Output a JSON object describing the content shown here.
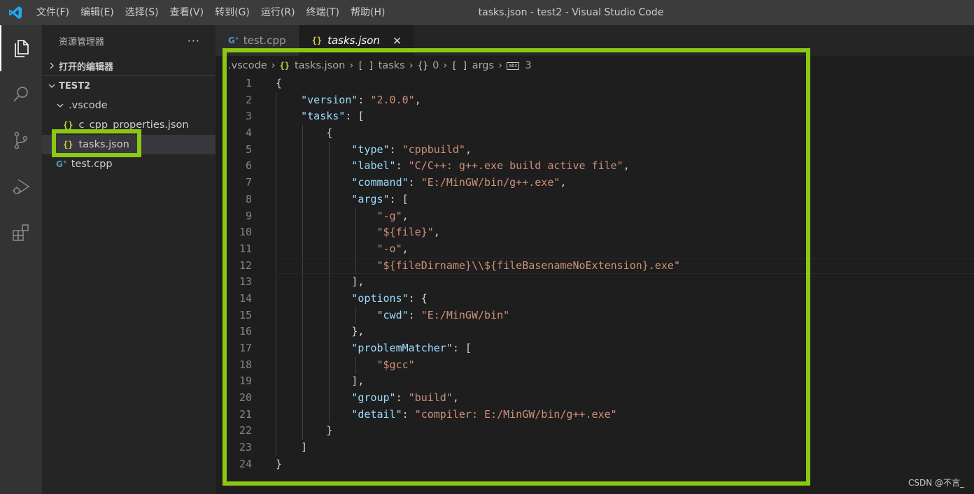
{
  "window_title": "tasks.json - test2 - Visual Studio Code",
  "menu": [
    "文件(F)",
    "编辑(E)",
    "选择(S)",
    "查看(V)",
    "转到(G)",
    "运行(R)",
    "终端(T)",
    "帮助(H)"
  ],
  "sidebar": {
    "title": "资源管理器",
    "more": "···",
    "open_editors": "打开的编辑器",
    "folder": "TEST2",
    "items": [
      {
        "label": ".vscode"
      },
      {
        "label": "c_cpp_properties.json"
      },
      {
        "label": "tasks.json"
      },
      {
        "label": "test.cpp"
      }
    ]
  },
  "tabs": [
    {
      "label": "test.cpp",
      "icon": "G"
    },
    {
      "label": "tasks.json",
      "icon": "{}",
      "close": "✕"
    }
  ],
  "breadcrumb": {
    "folder": ".vscode",
    "file": "tasks.json",
    "seg1": "tasks",
    "seg2": "0",
    "seg3": "args",
    "seg4": "3"
  },
  "code_lines": [
    {
      "n": "1",
      "html": "{"
    },
    {
      "n": "2",
      "html": "    <span class='k'>\"version\"</span>: <span class='s'>\"2.0.0\"</span>,"
    },
    {
      "n": "3",
      "html": "    <span class='k'>\"tasks\"</span>: ["
    },
    {
      "n": "4",
      "html": "        {"
    },
    {
      "n": "5",
      "html": "            <span class='k'>\"type\"</span>: <span class='s'>\"cppbuild\"</span>,"
    },
    {
      "n": "6",
      "html": "            <span class='k'>\"label\"</span>: <span class='s'>\"C/C++: g++.exe build active file\"</span>,"
    },
    {
      "n": "7",
      "html": "            <span class='k'>\"command\"</span>: <span class='s'>\"E:/MinGW/bin/g++.exe\"</span>,"
    },
    {
      "n": "8",
      "html": "            <span class='k'>\"args\"</span>: ["
    },
    {
      "n": "9",
      "html": "                <span class='s'>\"-g\"</span>,"
    },
    {
      "n": "10",
      "html": "                <span class='s'>\"${file}\"</span>,"
    },
    {
      "n": "11",
      "html": "                <span class='s'>\"-o\"</span>,"
    },
    {
      "n": "12",
      "html": "                <span class='s'>\"${fileDirname}\\\\${fileBasenameNoExtension}.exe\"</span>"
    },
    {
      "n": "13",
      "html": "            ],"
    },
    {
      "n": "14",
      "html": "            <span class='k'>\"options\"</span>: {"
    },
    {
      "n": "15",
      "html": "                <span class='k'>\"cwd\"</span>: <span class='s'>\"E:/MinGW/bin\"</span>"
    },
    {
      "n": "16",
      "html": "            },"
    },
    {
      "n": "17",
      "html": "            <span class='k'>\"problemMatcher\"</span>: ["
    },
    {
      "n": "18",
      "html": "                <span class='s'>\"$gcc\"</span>"
    },
    {
      "n": "19",
      "html": "            ],"
    },
    {
      "n": "20",
      "html": "            <span class='k'>\"group\"</span>: <span class='s'>\"build\"</span>,"
    },
    {
      "n": "21",
      "html": "            <span class='k'>\"detail\"</span>: <span class='s'>\"compiler: E:/MinGW/bin/g++.exe\"</span>"
    },
    {
      "n": "22",
      "html": "        }"
    },
    {
      "n": "23",
      "html": "    ]"
    },
    {
      "n": "24",
      "html": "}"
    }
  ],
  "current_line": "12",
  "watermark": "CSDN @不言_",
  "colors": {
    "highlight": "#8bc813",
    "json_key": "#9cdcfe",
    "json_string": "#ce9178",
    "json_icon": "#cbcb41",
    "cpp_icon": "#519aba"
  }
}
